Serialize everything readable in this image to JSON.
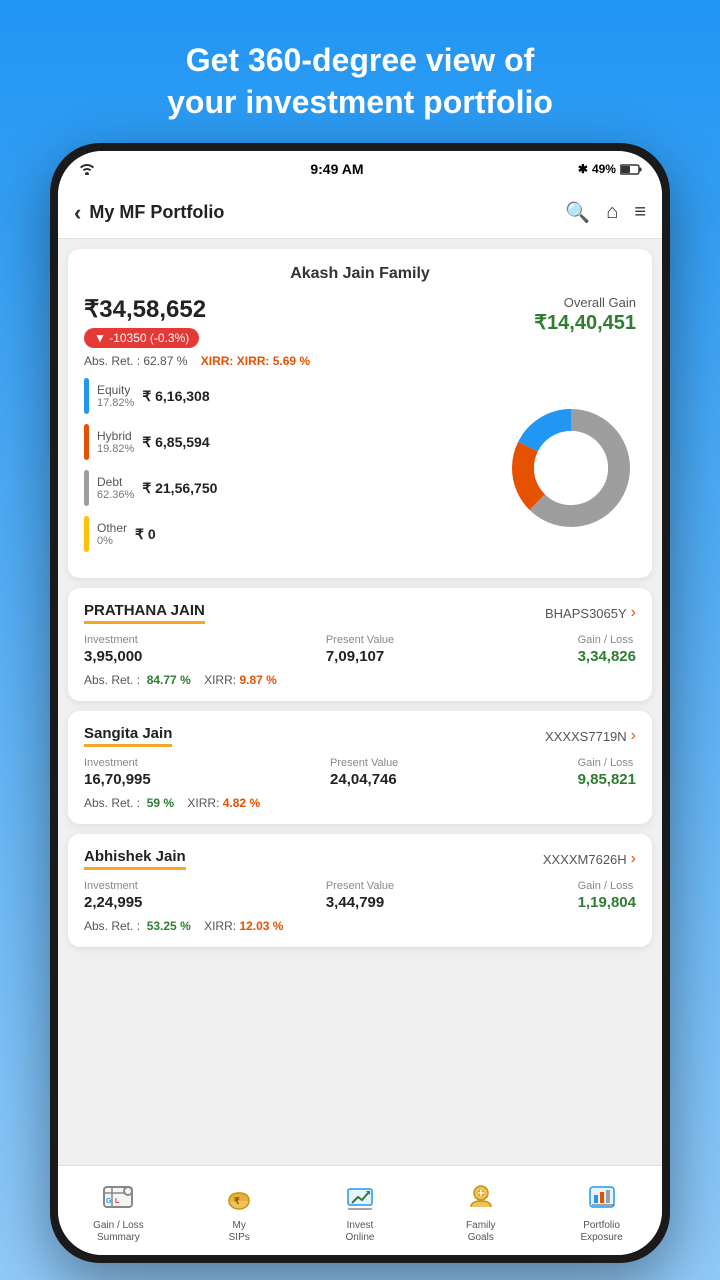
{
  "header": {
    "line1": "Get 360-degree view of",
    "line2": "your investment portfolio"
  },
  "statusBar": {
    "left": "WiFi",
    "time": "9:49 AM",
    "right": "49%"
  },
  "topBar": {
    "backIcon": "‹",
    "title": "My MF Portfolio",
    "searchIcon": "🔍",
    "homeIcon": "⌂",
    "menuIcon": "≡"
  },
  "portfolio": {
    "familyName": "Akash Jain Family",
    "totalValue": "₹34,58,652",
    "change": "▼ -10350  (-0.3%)",
    "absReturn": "Abs. Ret. :  62.87 %",
    "xirr": "XIRR: 5.69 %",
    "overallGainLabel": "Overall Gain",
    "overallGainValue": "₹14,40,451",
    "breakdown": [
      {
        "label": "Equity",
        "pct": "17.82%",
        "amount": "₹ 6,16,308",
        "color": "#2196F3"
      },
      {
        "label": "Hybrid",
        "pct": "19.82%",
        "amount": "₹ 6,85,594",
        "color": "#E65100"
      },
      {
        "label": "Debt",
        "pct": "62.36%",
        "amount": "₹ 21,56,750",
        "color": "#9E9E9E"
      },
      {
        "label": "Other",
        "pct": "0%",
        "amount": "₹ 0",
        "color": "#FFC107"
      }
    ]
  },
  "members": [
    {
      "name": "PRATHANA JAIN",
      "id": "BHAPS3065Y",
      "investment": "3,95,000",
      "presentValue": "7,09,107",
      "gainLoss": "3,34,826",
      "absReturn": "84.77 %",
      "xirr": "9.87 %"
    },
    {
      "name": "Sangita Jain",
      "id": "XXXXS7719N",
      "investment": "16,70,995",
      "presentValue": "24,04,746",
      "gainLoss": "9,85,821",
      "absReturn": "59 %",
      "xirr": "4.82 %"
    },
    {
      "name": "Abhishek Jain",
      "id": "XXXXM7626H",
      "investment": "2,24,995",
      "presentValue": "3,44,799",
      "gainLoss": "1,19,804",
      "absReturn": "53.25 %",
      "xirr": "12.03 %"
    }
  ],
  "bottomNav": [
    {
      "label": "Gain / Loss\nSummary",
      "icon": "gain-loss"
    },
    {
      "label": "My\nSIPs",
      "icon": "sips"
    },
    {
      "label": "Invest\nOnline",
      "icon": "invest"
    },
    {
      "label": "Family\nGoals",
      "icon": "goals"
    },
    {
      "label": "Portfolio\nExposure",
      "icon": "exposure"
    }
  ],
  "labels": {
    "investment": "Investment",
    "presentValue": "Present Value",
    "gainLoss": "Gain / Loss",
    "absRet": "Abs. Ret. :",
    "xirr": "XIRR:"
  }
}
